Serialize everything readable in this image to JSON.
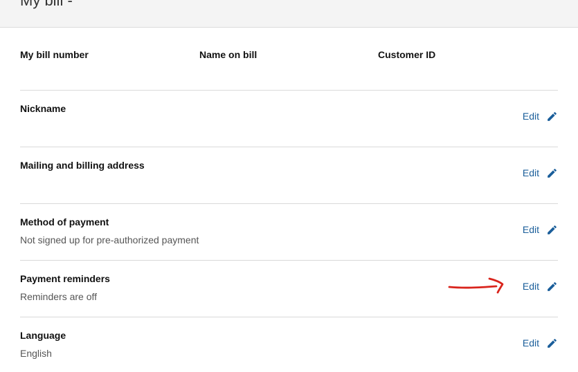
{
  "header": {
    "title": "My bill -"
  },
  "summary": {
    "bill_number_label": "My bill number",
    "name_on_bill_label": "Name on bill",
    "customer_id_label": "Customer ID"
  },
  "sections": [
    {
      "id": "nickname",
      "title": "Nickname",
      "value": "",
      "edit_label": "Edit"
    },
    {
      "id": "address",
      "title": "Mailing and billing address",
      "value": "",
      "edit_label": "Edit"
    },
    {
      "id": "payment",
      "title": "Method of payment",
      "value": "Not signed up for pre-authorized payment",
      "edit_label": "Edit"
    },
    {
      "id": "reminders",
      "title": "Payment reminders",
      "value": "Reminders are off",
      "edit_label": "Edit"
    },
    {
      "id": "language",
      "title": "Language",
      "value": "English",
      "edit_label": "Edit"
    }
  ],
  "colors": {
    "link": "#1a5e9a",
    "annotation": "#d9241c",
    "header_bg": "#f4f4f4",
    "divider": "#d9d9d9"
  },
  "icons": {
    "edit": "pencil-icon",
    "annotation": "red-arrow-annotation"
  }
}
